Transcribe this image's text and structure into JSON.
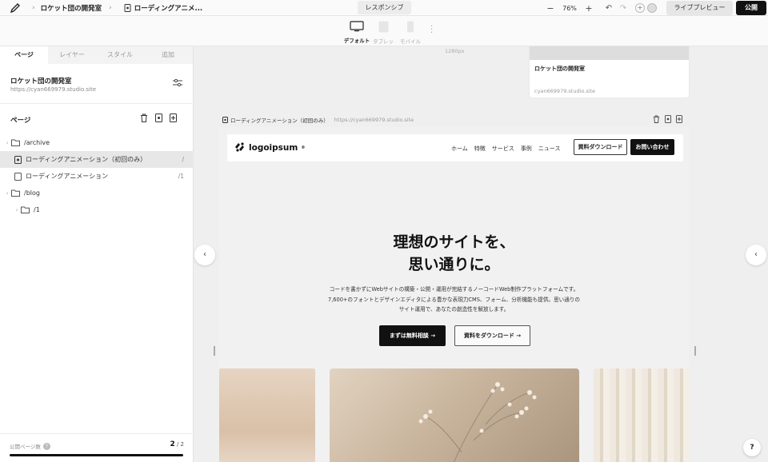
{
  "topbar": {
    "project": "ロケット団の開発室",
    "page": "ローディングアニメ...",
    "mode_tab": "レスポンシブ",
    "zoom_minus": "−",
    "zoom": "76%",
    "zoom_plus": "+",
    "undo": "↶",
    "redo": "↷",
    "live_preview": "ライブプレビュー",
    "publish": "公開"
  },
  "devices": [
    {
      "label": "デフォルト",
      "active": true
    },
    {
      "label": "タブレット",
      "active": false
    },
    {
      "label": "モバイル",
      "active": false
    }
  ],
  "left_panel": {
    "tabs": [
      "ページ",
      "レイヤー",
      "スタイル",
      "追加"
    ],
    "site_name": "ロケット団の開発室",
    "site_url": "https://cyan669979.studio.site",
    "pages_title": "ページ",
    "tree": [
      {
        "label": "/archive",
        "type": "folder",
        "chevron": "‹",
        "aux": ""
      },
      {
        "label": "ローディングアニメーション（初回のみ）",
        "type": "page-home",
        "chevron": "",
        "aux": "/"
      },
      {
        "label": "ローディングアニメーション",
        "type": "page",
        "chevron": "",
        "aux": "/1"
      },
      {
        "label": "/blog",
        "type": "folder",
        "chevron": "‹",
        "aux": ""
      },
      {
        "label": "/1",
        "type": "folder-child",
        "chevron": "›",
        "aux": ""
      }
    ],
    "footer_label": "公開ページ数",
    "footer_current": "2",
    "footer_total": "/ 2"
  },
  "canvas": {
    "ruler": "1280px",
    "ghost_title": "ロケット団の開発室",
    "ghost_url": "cyan669979.studio.site",
    "frame_title": "ローディングアニメーション（初回のみ）",
    "frame_url": "https://cyan669979.studio.site",
    "left_arrow": "‹",
    "right_arrow": "‹"
  },
  "site": {
    "logo": "logoipsum",
    "logo_mark": "®",
    "nav": [
      "ホーム",
      "特徴",
      "サービス",
      "事例",
      "ニュース"
    ],
    "download_btn": "資料ダウンロード",
    "contact_btn": "お問い合わせ",
    "hero_line1": "理想のサイトを、",
    "hero_line2": "思い通りに。",
    "sub_line1": "コードを書かずにWebサイトの構築・公開・運用が完結するノーコードWeb制作プラットフォームです。",
    "sub_line2": "7,600+のフォントとデザインエディタによる豊かな表現力CMS、フォーム、分析機能も提供。思い通りの",
    "sub_line3": "サイト運用で、あなたの創造性を解放します。",
    "cta_primary": "まずは無料相談 →",
    "cta_secondary": "資料をダウンロード →"
  },
  "help": "?"
}
